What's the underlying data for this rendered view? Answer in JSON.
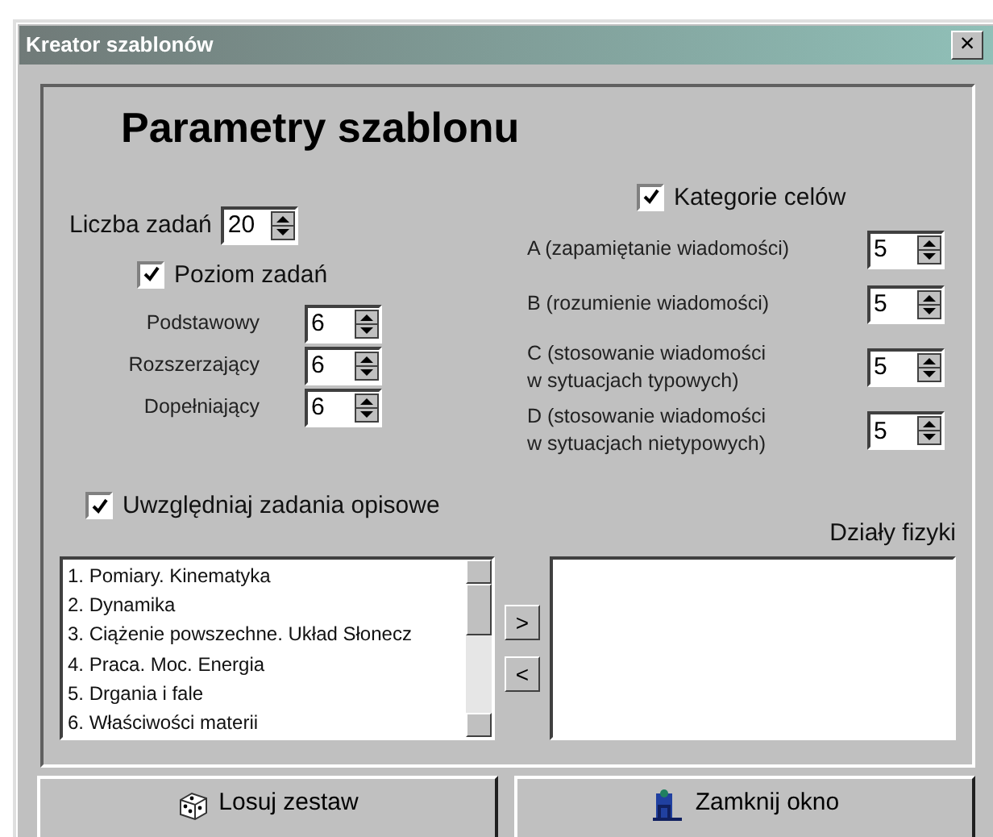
{
  "window": {
    "title": "Kreator szablonów",
    "close": "×"
  },
  "heading": "Parametry szablonu",
  "task_count": {
    "label": "Liczba zadań",
    "value": "20"
  },
  "level_group": {
    "label": "Poziom zadań",
    "checked": true,
    "rows": [
      {
        "label": "Podstawowy",
        "value": "6"
      },
      {
        "label": "Rozszerzający",
        "value": "6"
      },
      {
        "label": "Dopełniający",
        "value": "6"
      }
    ]
  },
  "categories": {
    "label": "Kategorie celów",
    "checked": true,
    "rows": [
      {
        "label": "A (zapamiętanie wiadomości)",
        "value": "5"
      },
      {
        "label": "B (rozumienie wiadomości)",
        "value": "5"
      },
      {
        "label": "C (stosowanie wiadomości\nw sytuacjach typowych)",
        "value": "5"
      },
      {
        "label": "D (stosowanie wiadomości\nw sytuacjach nietypowych)",
        "value": "5"
      }
    ]
  },
  "descriptive": {
    "label": "Uwzględniaj zadania opisowe",
    "checked": true
  },
  "sections": {
    "label": "Działy fizyki",
    "available": [
      "1. Pomiary. Kinematyka",
      "2. Dynamika",
      "3. Ciążenie powszechne. Układ Słonecz",
      "4. Praca. Moc. Energia",
      "5. Drgania i fale",
      "6. Właściwości materii"
    ],
    "move_buttons": [
      ">",
      "<"
    ]
  },
  "buttons": [
    {
      "kind": "dice",
      "label": "Losuj zestaw"
    },
    {
      "kind": "exit",
      "label": "Zamknij okno"
    }
  ]
}
